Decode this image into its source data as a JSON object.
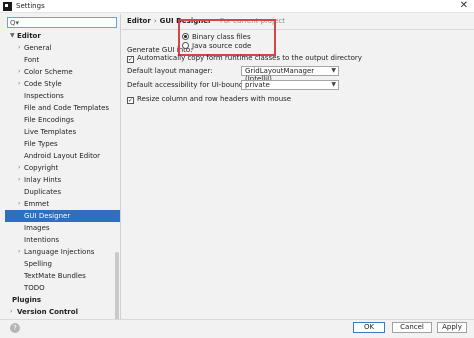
{
  "window": {
    "title": "Settings",
    "close_glyph": "✕"
  },
  "search": {
    "value": "",
    "placeholder": "Q▾"
  },
  "tree": {
    "editor": "Editor",
    "items": [
      "General",
      "Font",
      "Color Scheme",
      "Code Style",
      "Inspections",
      "File and Code Templates",
      "File Encodings",
      "Live Templates",
      "File Types",
      "Android Layout Editor",
      "Copyright",
      "Inlay Hints",
      "Duplicates",
      "Emmet",
      "GUI Designer",
      "Images",
      "Intentions",
      "Language Injections",
      "Spelling",
      "TextMate Bundles",
      "TODO"
    ],
    "plugins": "Plugins",
    "version_control": "Version Control"
  },
  "content": {
    "breadcrumb_section": "Editor",
    "breadcrumb_separator": "›",
    "breadcrumb_page": "GUI Designer",
    "breadcrumb_note": "For current project",
    "generate_label": "Generate GUI into:",
    "option_binary": "Binary class files",
    "option_java": "Java source code",
    "auto_copy": "Automatically copy form runtime classes to the output directory",
    "layout_manager_label": "Default layout manager:",
    "layout_manager_value": "GridLayoutManager (IntelliJ)",
    "accessibility_label": "Default accessibility for UI-bound fields:",
    "accessibility_value": "private",
    "resize": "Resize column and row headers with mouse"
  },
  "buttons": {
    "ok": "OK",
    "cancel": "Cancel",
    "apply": "Apply",
    "help": "?"
  },
  "colors": {
    "selection": "#2f6fbd",
    "highlight_box": "#d64545"
  }
}
